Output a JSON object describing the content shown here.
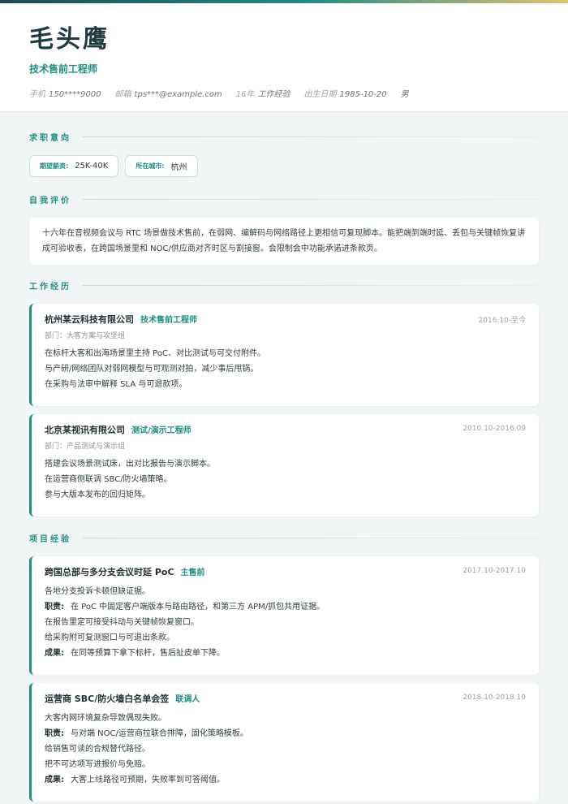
{
  "header": {
    "name": "毛头鹰",
    "role": "技术售前工程师",
    "contact": [
      {
        "key": "手机",
        "value": "150****9000"
      },
      {
        "key": "邮箱",
        "value": "tps***@example.com"
      },
      {
        "key": "16年",
        "value": "工作经验"
      },
      {
        "key": "出生日期",
        "value": "1985-10-20"
      },
      {
        "key": "",
        "value": "男"
      }
    ]
  },
  "intent": {
    "title": "求职意向",
    "salary_label": "期望薪资:",
    "salary_value": "25K-40K",
    "city_label": "所在城市:",
    "city_value": "杭州"
  },
  "summary": {
    "title": "自我评价",
    "text": "十六年在音视频会议与 RTC 场景做技术售前，在弱网、编解码与网络路径上更相信可复现脚本。能把端到端时延、丢包与关键帧恢复讲成可验收表，在跨国场景里和 NOC/供应商对齐时区与割接窗。会限制会中功能承诺进条款页。"
  },
  "work": {
    "title": "工作经历",
    "items": [
      {
        "org": "杭州某云科技有限公司",
        "role": "技术售前工程师",
        "date": "2016.10-至今",
        "dept": "部门：大客方案与攻坚组",
        "bullets": [
          "在标杆大客和出海场景里主持 PoC、对比测试与可交付附件。",
          "与产研/网络团队对弱网模型与可观测对拍，减少事后甩锅。",
          "在采购与法审中解释 SLA 与可退款项。"
        ]
      },
      {
        "org": "北京某视讯有限公司",
        "role": "测试/演示工程师",
        "date": "2010.10-2016.09",
        "dept": "部门：产品测试与演示组",
        "bullets": [
          "搭建会议场景测试床，出对比报告与演示脚本。",
          "在运营商侧联调 SBC/防火墙策略。",
          "参与大版本发布的回归矩阵。"
        ]
      }
    ]
  },
  "projects": {
    "title": "项目经验",
    "duty_label": "职责:",
    "result_label": "成果:",
    "items": [
      {
        "name": "跨国总部与多分支会议时延 PoC",
        "role": "主售前",
        "date": "2017.10-2017.10",
        "background": "各地分支投诉卡顿但缺证据。",
        "duties": [
          "在 PoC 中固定客户端版本与路由路径，和第三方 APM/抓包共用证据。",
          "在报告里定可接受抖动与关键帧恢复窗口。",
          "给采购附可复测窗口与可退出条款。"
        ],
        "result": "在同等预算下拿下标杆，售后扯皮单下降。"
      },
      {
        "name": "运营商 SBC/防火墙白名单会签",
        "role": "联调人",
        "date": "2018.10-2018.10",
        "background": "大客内网环境复杂导致偶现失败。",
        "duties": [
          "与对端 NOC/运营商拉联合排障，固化策略模板。",
          "给销售可读的合规替代路径。",
          "把不可达项写进报价与免赔。"
        ],
        "result": "大客上线路径可预期，失败率到可答阈值。"
      }
    ]
  }
}
